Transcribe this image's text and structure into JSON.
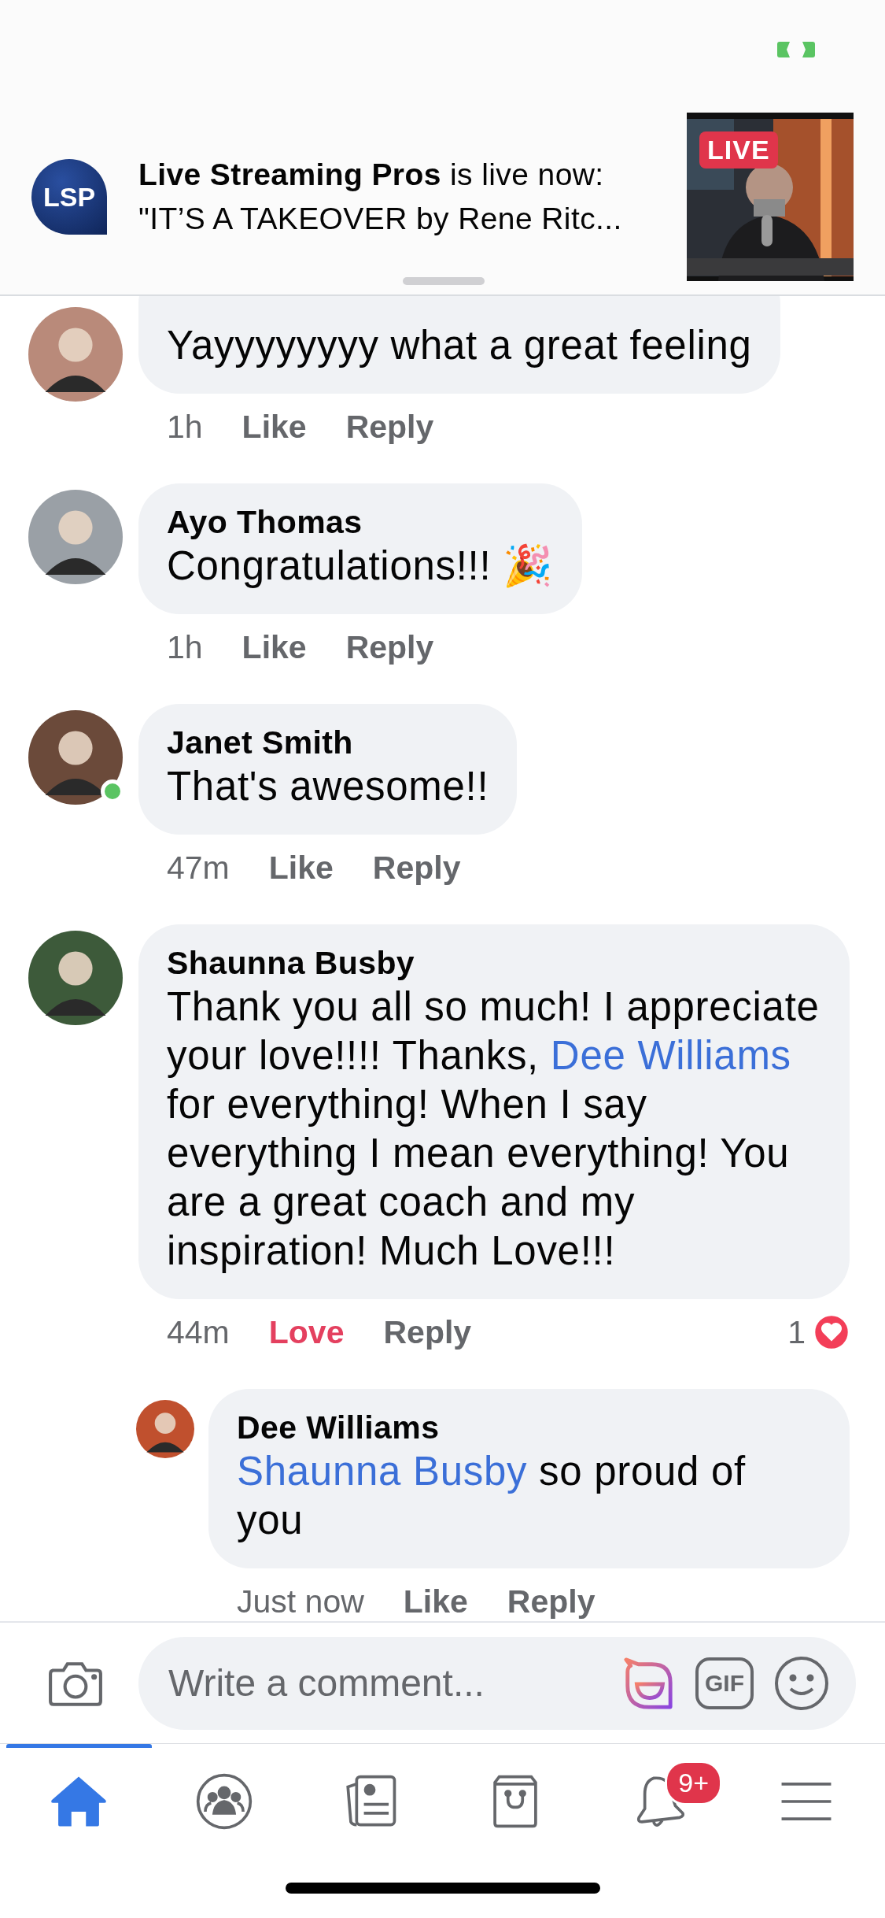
{
  "notification": {
    "logo_text": "LSP",
    "sender": "Live Streaming Pros",
    "action": "is live now:",
    "message": "\"IT’S A TAKEOVER by Rene Ritc...",
    "badge": "LIVE"
  },
  "comments": [
    {
      "online": false,
      "body": [
        {
          "kind": "text",
          "text": "Yayyyyyyyy what a great feeling"
        }
      ],
      "time": "1h",
      "reaction": {
        "label": "Like",
        "selected": false
      },
      "reply_label": "Reply"
    },
    {
      "name": "Ayo Thomas",
      "online": false,
      "body": [
        {
          "kind": "text",
          "text": "Congratulations!!! 🎉"
        }
      ],
      "time": "1h",
      "reaction": {
        "label": "Like",
        "selected": false
      },
      "reply_label": "Reply"
    },
    {
      "name": "Janet Smith",
      "online": true,
      "body": [
        {
          "kind": "text",
          "text": "That's awesome!!"
        }
      ],
      "time": "47m",
      "reaction": {
        "label": "Like",
        "selected": false
      },
      "reply_label": "Reply"
    },
    {
      "name": "Shaunna Busby",
      "online": false,
      "body": [
        {
          "kind": "text",
          "text": "Thank you all so much! I appreciate your love!!!! Thanks, "
        },
        {
          "kind": "mention",
          "text": "Dee Williams"
        },
        {
          "kind": "text",
          "text": " for everything! When I say everything I mean everything! You are a great coach and my inspiration! Much Love!!!"
        }
      ],
      "time": "44m",
      "reaction": {
        "label": "Love",
        "selected": true
      },
      "reply_label": "Reply",
      "reaction_count": "1",
      "replies": [
        {
          "name": "Dee Williams",
          "online": false,
          "body": [
            {
              "kind": "mention",
              "text": "Shaunna Busby"
            },
            {
              "kind": "text",
              "text": " so proud of you"
            }
          ],
          "time": "Just now",
          "reaction": {
            "label": "Like",
            "selected": false
          },
          "reply_label": "Reply"
        }
      ]
    }
  ],
  "composer": {
    "placeholder": "Write a comment...",
    "gif_label": "GIF"
  },
  "tabs": [
    {
      "kind": "home",
      "selected": true
    },
    {
      "kind": "groups",
      "selected": false
    },
    {
      "kind": "news",
      "selected": false
    },
    {
      "kind": "marketplace",
      "selected": false
    },
    {
      "kind": "notifications",
      "selected": false,
      "badge": "9+"
    },
    {
      "kind": "menu",
      "selected": false
    }
  ]
}
